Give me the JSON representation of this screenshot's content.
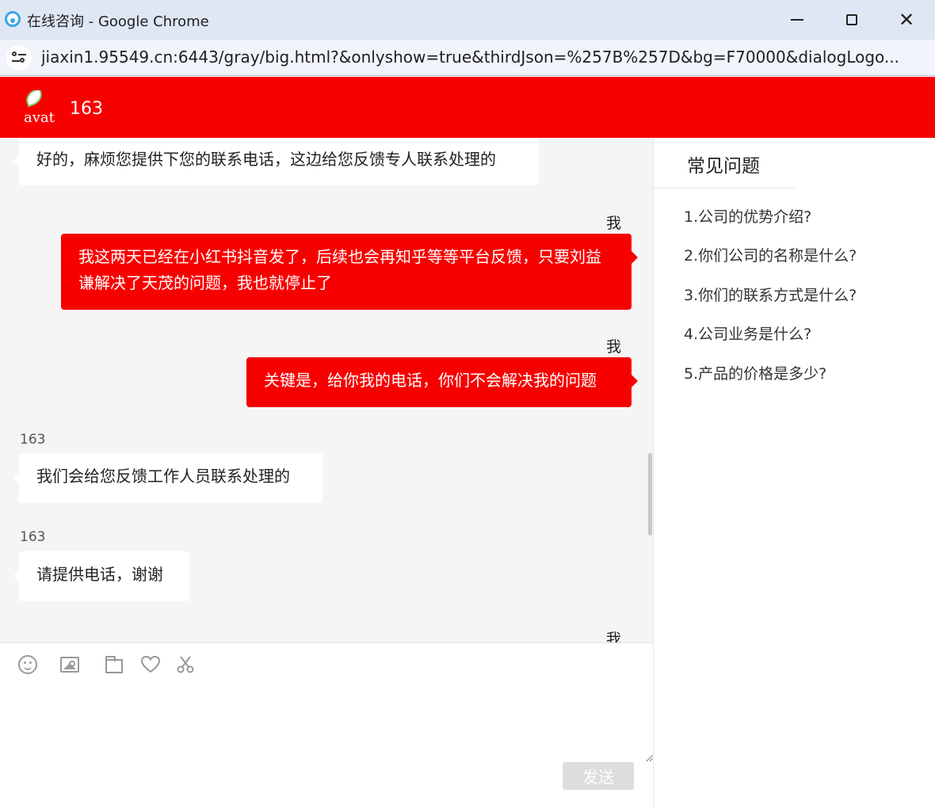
{
  "window": {
    "title": "在线咨询 - Google Chrome",
    "url": "jiaxin1.95549.cn:6443/gray/big.html?&onlyshow=true&thirdJson=%257B%257D&bg=F70000&dialogLogo..."
  },
  "header": {
    "avatar_alt": "avat",
    "name": "163"
  },
  "messages": [
    {
      "side": "left",
      "sender": "",
      "text": "好的，麻烦您提供下您的联系电话，这边给您反馈专人联系处理的"
    },
    {
      "side": "right",
      "sender": "我",
      "text": "我这两天已经在小红书抖音发了，后续也会再知乎等等平台反馈，只要刘益谦解决了天茂的问题，我也就停止了"
    },
    {
      "side": "right",
      "sender": "我",
      "text": "关键是，给你我的电话，你们不会解决我的问题"
    },
    {
      "side": "left",
      "sender": "163",
      "text": "我们会给您反馈工作人员联系处理的"
    },
    {
      "side": "left",
      "sender": "163",
      "text": "请提供电话，谢谢"
    },
    {
      "side": "right",
      "sender": "我",
      "text": ""
    }
  ],
  "toolbar": {
    "icons": [
      "emoji-icon",
      "image-icon",
      "folder-icon",
      "heart-icon",
      "scissors-icon"
    ]
  },
  "composer": {
    "value": "",
    "send_label": "发送"
  },
  "faq": {
    "title": "常见问题",
    "items": [
      "1.公司的优势介绍?",
      "2.你们公司的名称是什么?",
      "3.你们的联系方式是什么?",
      "4.公司业务是什么?",
      "5.产品的价格是多少?"
    ]
  },
  "colors": {
    "brand": "#f70000",
    "chat_bg": "#f5f5f5",
    "send_disabled": "#dddddd"
  }
}
